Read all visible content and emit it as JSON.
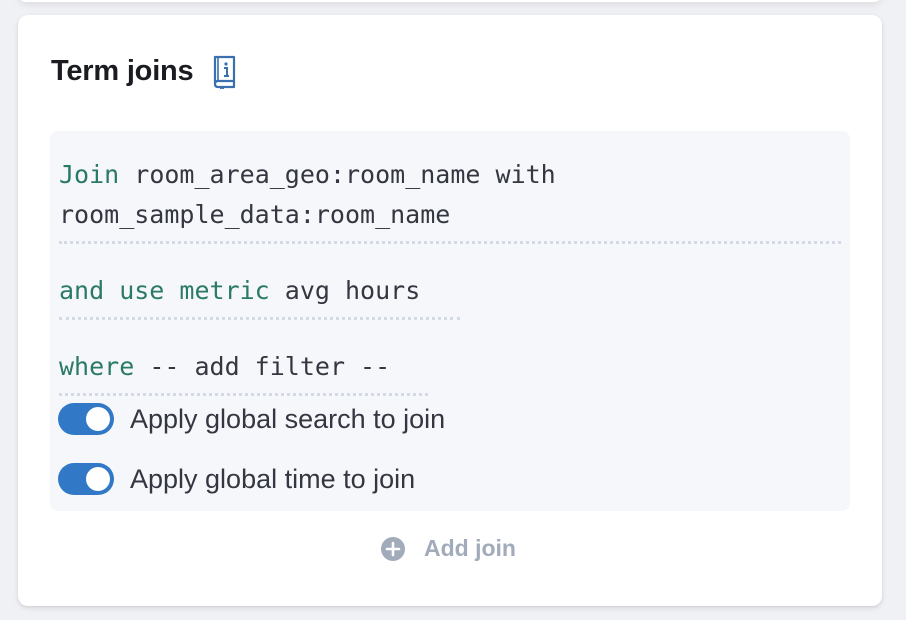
{
  "panel": {
    "title": "Term joins",
    "docs_icon": "book-info-icon"
  },
  "join": {
    "line1_keyword": "Join",
    "line1_text": "room_area_geo:room_name with",
    "line2_text": "room_sample_data:room_name",
    "metric_keyword": "and use metric",
    "metric_text": "avg hours",
    "where_keyword": "where",
    "where_text": "-- add filter --",
    "toggles": [
      {
        "label": "Apply global search to join",
        "checked": true
      },
      {
        "label": "Apply global time to join",
        "checked": true
      }
    ]
  },
  "actions": {
    "add_join_label": "Add join",
    "add_join_icon": "plus-circle-icon"
  },
  "colors": {
    "keyword": "#2b7a68",
    "toggle_on": "#3178c6",
    "muted": "#a2abba",
    "box_bg": "#f5f7fa"
  }
}
